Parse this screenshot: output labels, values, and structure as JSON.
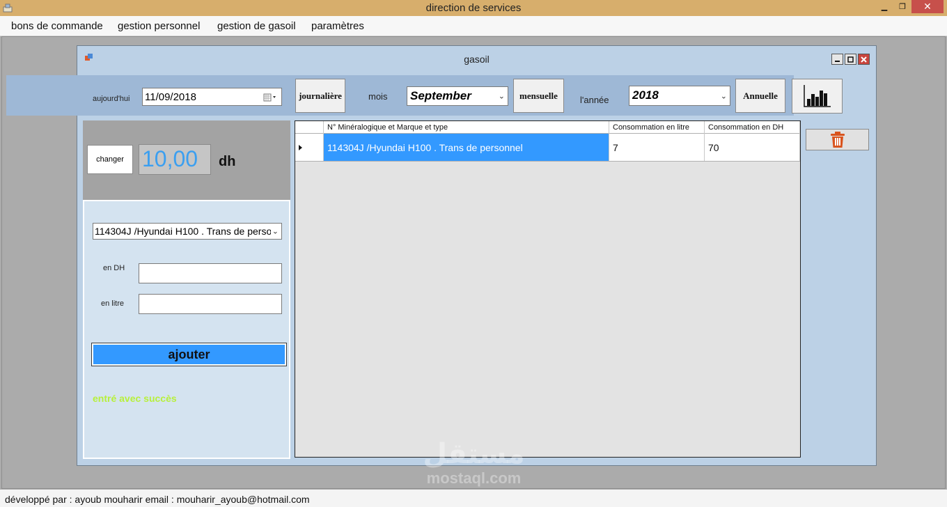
{
  "window": {
    "title": "direction de services",
    "minimize": "▁",
    "maximize": "❐",
    "close": "✕"
  },
  "menu": [
    "bons de commande",
    "gestion personnel",
    "gestion de gasoil",
    "paramètres"
  ],
  "child": {
    "title": "gasoil"
  },
  "toolbar": {
    "today_label": "aujourd'hui",
    "today_value": "11/09/2018",
    "daily_button": "journalière",
    "month_label": "mois",
    "month_value": "September",
    "monthly_button": "mensuelle",
    "year_label": "l'année",
    "year_value": "2018",
    "annual_button": "Annuelle",
    "chart_icon": "bar-chart-icon"
  },
  "price_panel": {
    "change_button": "changer",
    "price_value": "10,00",
    "unit": "dh"
  },
  "entry_panel": {
    "vehicle_select": "114304J /Hyundai H100 . Trans de person",
    "dh_label": "en DH",
    "dh_value": "",
    "litre_label": "en litre",
    "litre_value": "",
    "add_button": "ajouter",
    "success_message": "entré avec succès"
  },
  "grid": {
    "columns": [
      "N° Minéralogique et Marque et type",
      "Consommation en litre",
      "Consommation en DH"
    ],
    "rows": [
      [
        "114304J /Hyundai H100 . Trans de personnel",
        "7",
        "70"
      ]
    ]
  },
  "delete_icon": "trash-icon",
  "status_bar": "développé par : ayoub mouharir   email :  mouharir_ayoub@hotmail.com",
  "watermark": {
    "arabic": "مستقل",
    "latin": "mostaql.com"
  },
  "colors": {
    "titlebar": "#d7ae6c",
    "selection": "#3399ff",
    "price_text": "#3b9ff0",
    "success_text": "#b7f03a",
    "trash": "#d9541e"
  }
}
